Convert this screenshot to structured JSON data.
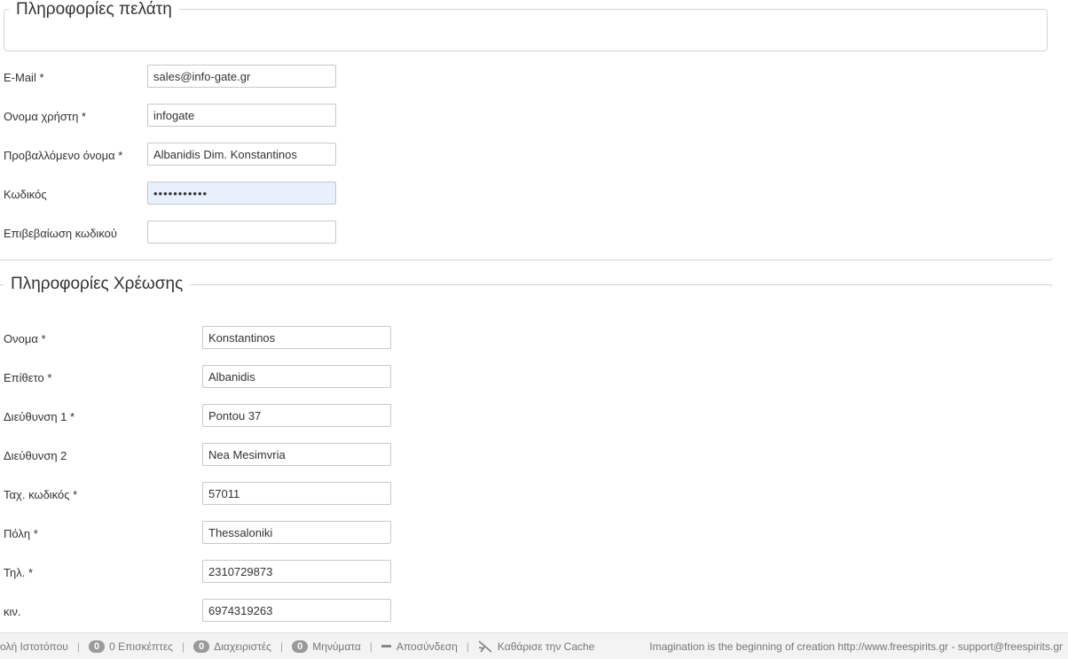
{
  "customer": {
    "legend": "Πληροφορίες πελάτη",
    "fields": [
      {
        "label": "E-Mail *",
        "value": "sales@info-gate.gr"
      },
      {
        "label": "Ονομα χρήστη *",
        "value": "infogate"
      },
      {
        "label": "Προβαλλόμενο όνομα *",
        "value": "Albanidis Dim. Konstantinos"
      },
      {
        "label": "Κωδικός",
        "value": "•••••••••••"
      },
      {
        "label": "Επιβεβαίωση κωδικού",
        "value": ""
      }
    ]
  },
  "billing": {
    "legend": "Πληροφορίες Χρέωσης",
    "fields": [
      {
        "label": "Ονομα *",
        "value": "Konstantinos"
      },
      {
        "label": "Επίθετο *",
        "value": "Albanidis"
      },
      {
        "label": "Διεύθυνση 1 *",
        "value": "Pontou 37"
      },
      {
        "label": "Διεύθυνση 2",
        "value": "Nea Mesimvria"
      },
      {
        "label": "Ταχ. κωδικός *",
        "value": "57011"
      },
      {
        "label": "Πόλη *",
        "value": "Thessaloniki"
      },
      {
        "label": "Τηλ. *",
        "value": "2310729873"
      },
      {
        "label": "κιν.",
        "value": "6974319263"
      }
    ]
  },
  "statusbar": {
    "site_view": "ολή Ιστοτόπου",
    "visitors_count": "0",
    "visitors_label": "0 Επισκέπτες",
    "admins_count": "0",
    "admins_label": "Διαχειριστές",
    "messages_count": "0",
    "messages_label": "Μηνύματα",
    "logout_label": "Αποσύνδεση",
    "clear_cache_label": "Καθάρισε την Cache",
    "tagline": "Imagination is the beginning of creation http://www.freespirits.gr - support@freespirits.gr"
  }
}
